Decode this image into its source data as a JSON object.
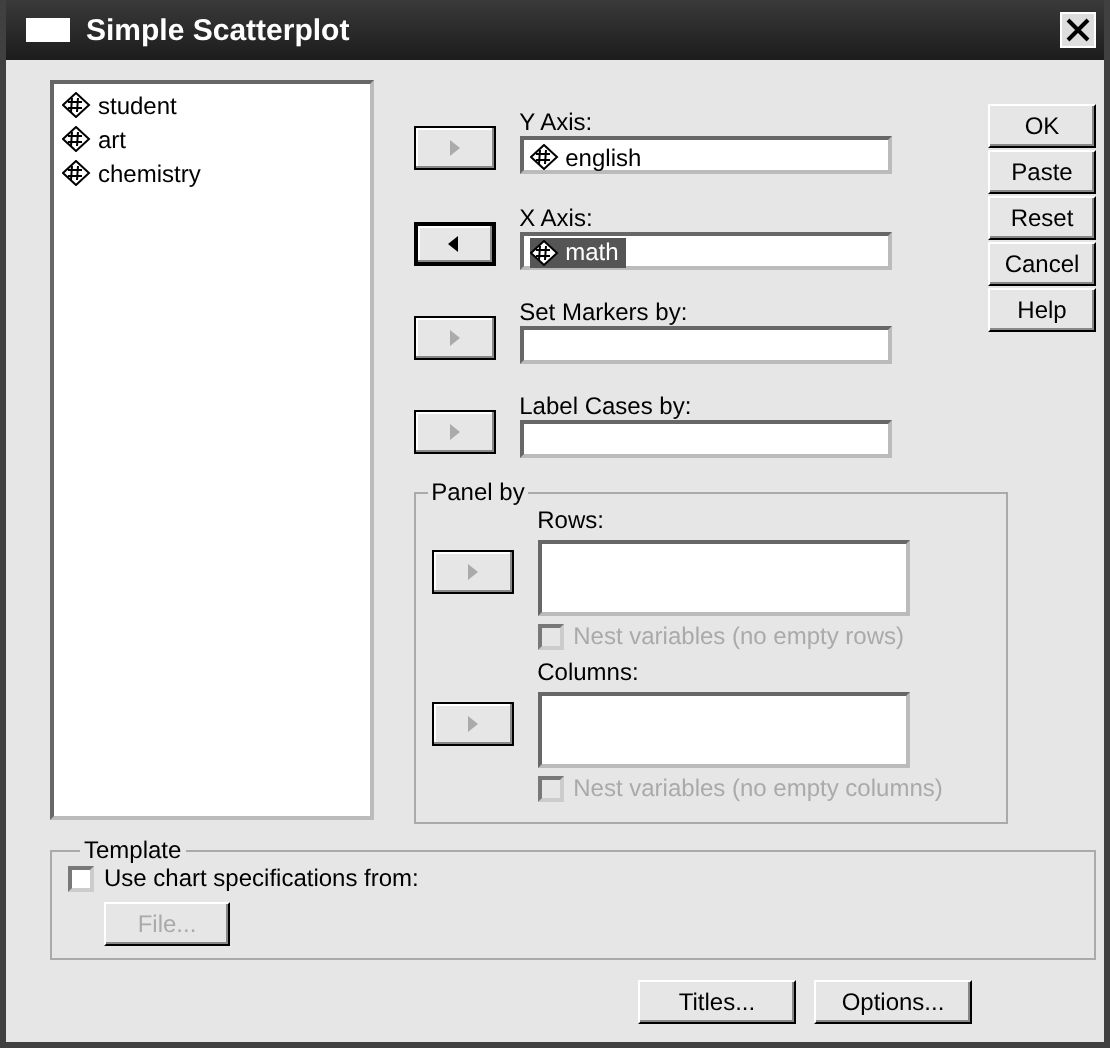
{
  "window": {
    "title": "Simple Scatterplot"
  },
  "variables": [
    {
      "name": "student",
      "selected": false
    },
    {
      "name": "art",
      "selected": false
    },
    {
      "name": "chemistry",
      "selected": false
    }
  ],
  "targets": [
    {
      "label": "Y Axis:",
      "kind": "add",
      "active": false,
      "items": [
        {
          "name": "english",
          "selected": false
        }
      ]
    },
    {
      "label": "X Axis:",
      "kind": "remove",
      "active": true,
      "items": [
        {
          "name": "math",
          "selected": true
        }
      ]
    },
    {
      "label": "Set Markers by:",
      "kind": "add",
      "active": false
    },
    {
      "label": "Label Cases by:",
      "kind": "add",
      "active": false
    }
  ],
  "panel_by": {
    "title": "Panel by",
    "lists": [
      {
        "label": "Rows:",
        "kind": "add",
        "active": false,
        "nest": {
          "label": "Nest variables (no empty rows)",
          "checked": false,
          "disabled": true
        }
      },
      {
        "label": "Columns:",
        "kind": "add",
        "active": false,
        "nest": {
          "label": "Nest variables (no empty columns)",
          "checked": false,
          "disabled": true
        }
      }
    ]
  },
  "side_buttons": [
    {
      "label": "OK",
      "disabled": false
    },
    {
      "label": "Paste",
      "disabled": false
    },
    {
      "label": "Reset",
      "disabled": false
    },
    {
      "label": "Cancel",
      "disabled": false
    },
    {
      "label": "Help",
      "disabled": false
    }
  ],
  "template": {
    "title": "Template",
    "checkbox": {
      "label": "Use chart specifications from:",
      "checked": false,
      "disabled": false
    },
    "file_button": {
      "label": "File...",
      "disabled": true
    }
  },
  "bottom_buttons": [
    {
      "label": "Titles...",
      "disabled": false
    },
    {
      "label": "Options...",
      "disabled": false
    }
  ]
}
